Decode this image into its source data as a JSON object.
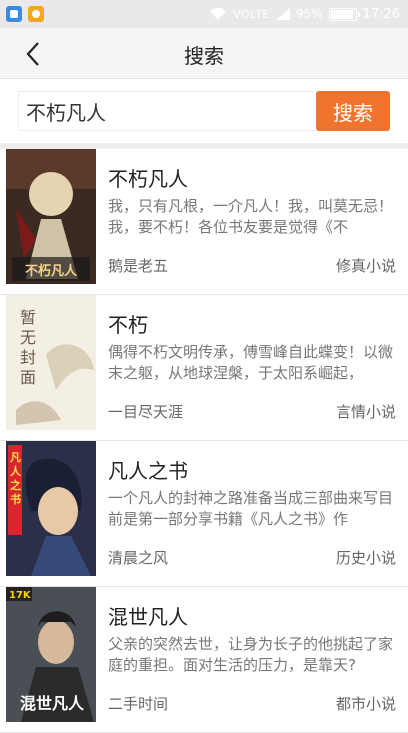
{
  "status_bar": {
    "network": "VOLTE",
    "battery": "95%",
    "battery_level": 0.95,
    "time": "17:26"
  },
  "header": {
    "back_icon": "chevron-left-icon",
    "title": "搜索"
  },
  "search": {
    "value": "不朽凡人",
    "button_label": "搜索"
  },
  "colors": {
    "accent": "#f0742e",
    "status_bar": "#e9e9e9"
  },
  "results": [
    {
      "title": "不朽凡人",
      "description": "我，只有凡根，一介凡人！我，叫莫无忌！我，要不朽！各位书友要是觉得《不",
      "author": "鹅是老五",
      "category": "修真小说",
      "cover_text": "不朽凡人"
    },
    {
      "title": "不朽",
      "description": "偶得不朽文明传承，傅雪峰自此蝶变！以微末之躯，从地球涅槃，于太阳系崛起，",
      "author": "一目尽天涯",
      "category": "言情小说",
      "cover_text": "暂无封面"
    },
    {
      "title": "凡人之书",
      "description": "一个凡人的封神之路准备当成三部曲来写目前是第一部分享书籍《凡人之书》作",
      "author": "清晨之风",
      "category": "历史小说",
      "cover_text": "凡人之书"
    },
    {
      "title": "混世凡人",
      "description": "父亲的突然去世，让身为长子的他挑起了家庭的重担。面对生活的压力，是靠天?",
      "author": "二手时间",
      "category": "都市小说",
      "cover_text": "混世凡人",
      "cover_badge": "17K"
    }
  ]
}
